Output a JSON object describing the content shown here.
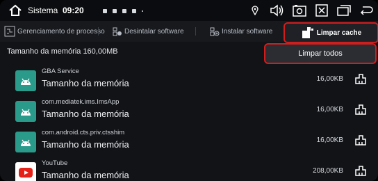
{
  "statusbar": {
    "title": "Sistema",
    "time": "09:20"
  },
  "tabs": [
    {
      "label": "Gerenciamento de processo",
      "icon": "process-icon"
    },
    {
      "label": "Desintalar software",
      "icon": "uninstall-icon"
    },
    {
      "label": "Instalar software",
      "icon": "install-icon"
    },
    {
      "label": "Limpar cache",
      "icon": "clean-cache-icon",
      "active": true
    }
  ],
  "storage_label": "Tamanho da memória 160,00MB",
  "popup": {
    "label": "Limpar todos"
  },
  "apps": [
    {
      "name": "GBA Service",
      "subtitle": "Tamanho da memória",
      "size": "16,00KB",
      "icon": "android-icon"
    },
    {
      "name": "com.mediatek.ims.ImsApp",
      "subtitle": "Tamanho da memória",
      "size": "16,00KB",
      "icon": "android-icon"
    },
    {
      "name": "com.android.cts.priv.ctsshim",
      "subtitle": "Tamanho da memória",
      "size": "16,00KB",
      "icon": "android-icon"
    },
    {
      "name": "YouTube",
      "subtitle": "Tamanho da memória",
      "size": "208,00KB",
      "icon": "youtube-icon"
    }
  ],
  "colors": {
    "accent": "#d21d1d",
    "android_tile": "#2a9a8b",
    "youtube_red": "#e62117"
  }
}
